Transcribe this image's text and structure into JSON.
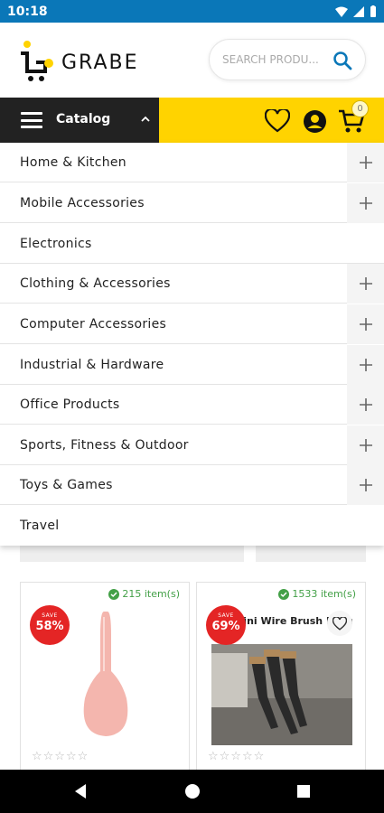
{
  "status_bar": {
    "time": "10:18"
  },
  "header": {
    "logo_text": "GRABE",
    "search_placeholder": "SEARCH PRODU..."
  },
  "navbar": {
    "catalog_label": "Catalog",
    "cart_count": "0"
  },
  "categories": [
    {
      "name": "Home & Kitchen",
      "expandable": true
    },
    {
      "name": "Mobile Accessories",
      "expandable": true
    },
    {
      "name": "Electronics",
      "expandable": false
    },
    {
      "name": "Clothing & Accessories",
      "expandable": true
    },
    {
      "name": "Computer Accessories",
      "expandable": true
    },
    {
      "name": "Industrial & Hardware",
      "expandable": true
    },
    {
      "name": "Office Products",
      "expandable": true
    },
    {
      "name": "Sports, Fitness & Outdoor",
      "expandable": true
    },
    {
      "name": "Toys & Games",
      "expandable": true
    },
    {
      "name": "Travel",
      "expandable": false
    }
  ],
  "products": [
    {
      "stock": "215 item(s)",
      "save_label": "SAVE",
      "save_pct": "58%",
      "title": "",
      "rating": 0
    },
    {
      "stock": "1533 item(s)",
      "save_label": "SAVE",
      "save_pct": "69%",
      "title": "ecs Mini Wire Brush Nylon/Brass Bru",
      "rating": 0
    }
  ],
  "colors": {
    "accent": "#ffd300",
    "status_bar": "#0a77b8",
    "save_badge": "#e42525",
    "in_stock": "#43a047"
  }
}
